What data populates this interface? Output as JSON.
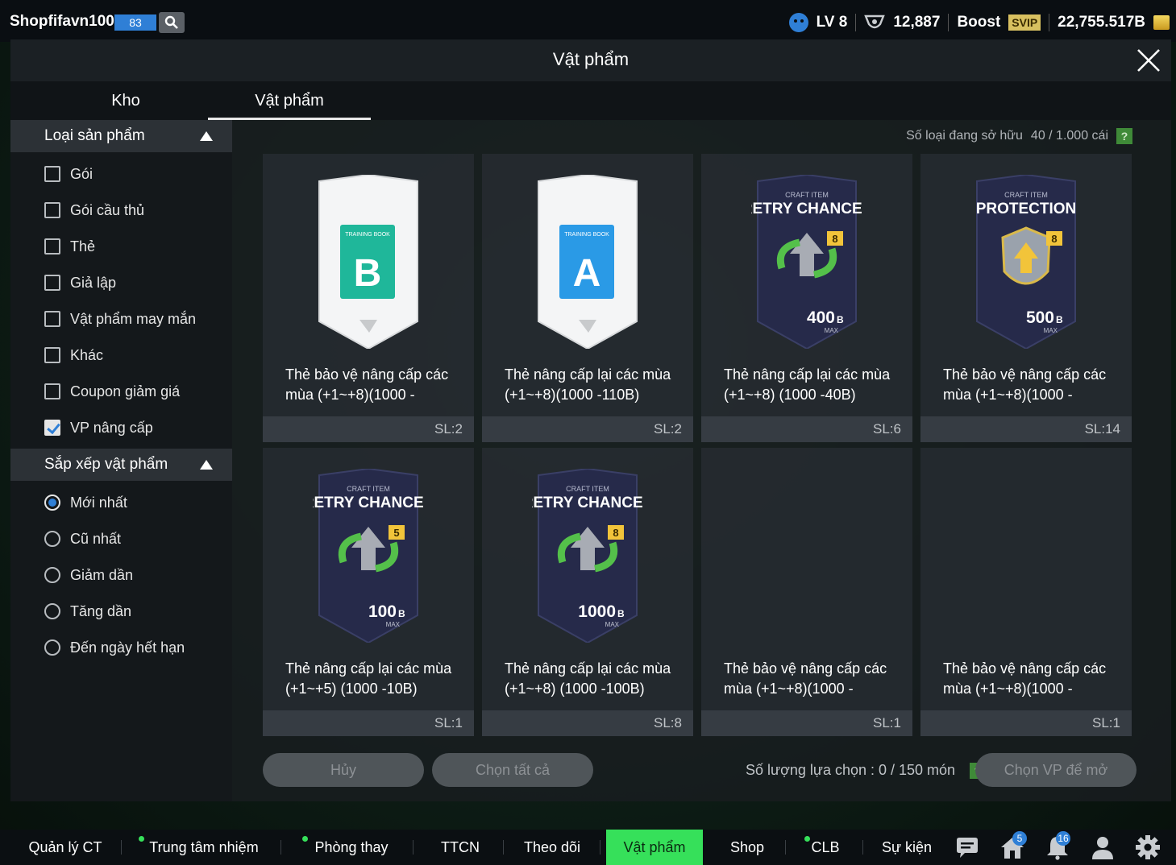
{
  "topbar": {
    "user_name": "Shopfifavn100R",
    "user_level": "83",
    "account_level": "LV 8",
    "trophies": "12,887",
    "boost_label": "Boost",
    "svip_label": "SVIP",
    "balance": "22,755.517B"
  },
  "modal": {
    "title": "Vật phẩm",
    "tabs": [
      {
        "label": "Kho",
        "active": false
      },
      {
        "label": "Vật phẩm",
        "active": true
      }
    ]
  },
  "sidebar": {
    "category_title": "Loại sản phẩm",
    "categories": [
      {
        "label": "Gói",
        "checked": false
      },
      {
        "label": "Gói cầu thủ",
        "checked": false
      },
      {
        "label": "Thẻ",
        "checked": false
      },
      {
        "label": "Giả lập",
        "checked": false
      },
      {
        "label": "Vật phẩm may mắn",
        "checked": false
      },
      {
        "label": "Khác",
        "checked": false
      },
      {
        "label": "Coupon giảm giá",
        "checked": false
      },
      {
        "label": "VP nâng cấp",
        "checked": true
      }
    ],
    "sort_title": "Sắp xếp vật phẩm",
    "sorts": [
      {
        "label": "Mới nhất",
        "selected": true
      },
      {
        "label": "Cũ nhất",
        "selected": false
      },
      {
        "label": "Giảm dần",
        "selected": false
      },
      {
        "label": "Tăng dần",
        "selected": false
      },
      {
        "label": "Đến ngày hết hạn",
        "selected": false
      }
    ]
  },
  "owned": {
    "label": "Số loại đang sở hữu",
    "value": "40 / 1.000 cái",
    "help": "?"
  },
  "items": [
    {
      "name": "Thẻ bảo vệ nâng cấp các mùa (+1~+8)(1000 -",
      "qty": "SL:2",
      "kind": "book",
      "book_label": "TRAINING BOOK",
      "book_letter": "B",
      "book_color": "#1fb79a"
    },
    {
      "name": "Thẻ nâng cấp lại các mùa (+1~+8)(1000 -110B)",
      "qty": "SL:2",
      "kind": "book",
      "book_label": "TRAINING BOOK",
      "book_letter": "A",
      "book_color": "#2a9ae6"
    },
    {
      "name": "Thẻ nâng cấp lại các mùa (+1~+8) (1000 -40B)",
      "qty": "SL:6",
      "kind": "retry",
      "craft_label": "CRAFT ITEM",
      "card_title": "RETRY CHANCES",
      "level": "8",
      "amount": "400",
      "amount_unit": "B",
      "max_label": "MAX"
    },
    {
      "name": "Thẻ bảo vệ nâng cấp các mùa (+1~+8)(1000 -",
      "qty": "SL:14",
      "kind": "protect",
      "craft_label": "CRAFT ITEM",
      "card_title": "PROTECTION",
      "level": "8",
      "amount": "500",
      "amount_unit": "B",
      "max_label": "MAX"
    },
    {
      "name": "Thẻ nâng cấp lại các mùa (+1~+5) (1000 -10B)",
      "qty": "SL:1",
      "kind": "retry",
      "craft_label": "CRAFT ITEM",
      "card_title": "RETRY CHANCES",
      "level": "5",
      "amount": "100",
      "amount_unit": "B",
      "max_label": "MAX"
    },
    {
      "name": "Thẻ nâng cấp lại các mùa (+1~+8) (1000 -100B)",
      "qty": "SL:8",
      "kind": "retry",
      "craft_label": "CRAFT ITEM",
      "card_title": "RETRY CHANCES",
      "level": "8",
      "amount": "1000",
      "amount_unit": "B",
      "max_label": "MAX"
    },
    {
      "name": "Thẻ bảo vệ nâng cấp các mùa (+1~+8)(1000 -",
      "qty": "SL:1",
      "kind": "empty"
    },
    {
      "name": "Thẻ bảo vệ nâng cấp các mùa (+1~+8)(1000 -",
      "qty": "SL:1",
      "kind": "empty"
    }
  ],
  "actions": {
    "cancel": "Hủy",
    "select_all": "Chọn tất cả",
    "select_count_label": "Số lượng lựa chọn : 0 / 150 món",
    "help": "?",
    "open": "Chọn VP để mở"
  },
  "bottom_nav": [
    {
      "label": "Quản lý CT",
      "dot": false,
      "active": false
    },
    {
      "label": "Trung tâm nhiệm vụ",
      "dot": true,
      "active": false
    },
    {
      "label": "Phòng thay đồ",
      "dot": true,
      "active": false
    },
    {
      "label": "TTCN",
      "dot": false,
      "active": false
    },
    {
      "label": "Theo dõi",
      "dot": false,
      "active": false
    },
    {
      "label": "Vật phẩm",
      "dot": false,
      "active": true
    },
    {
      "label": "Shop",
      "dot": false,
      "active": false
    },
    {
      "label": "CLB",
      "dot": true,
      "active": false
    },
    {
      "label": "Sự kiện",
      "dot": false,
      "active": false
    }
  ],
  "nav_icons": [
    {
      "icon": "chat-icon",
      "badge": ""
    },
    {
      "icon": "home-icon",
      "badge": "5"
    },
    {
      "icon": "bell-icon",
      "badge": "16"
    },
    {
      "icon": "profile-icon",
      "badge": ""
    },
    {
      "icon": "gear-icon",
      "badge": ""
    }
  ],
  "colors": {
    "accent_green": "#36e05a",
    "accent_blue": "#2f7fd6",
    "svip_gold": "#d8c060"
  }
}
